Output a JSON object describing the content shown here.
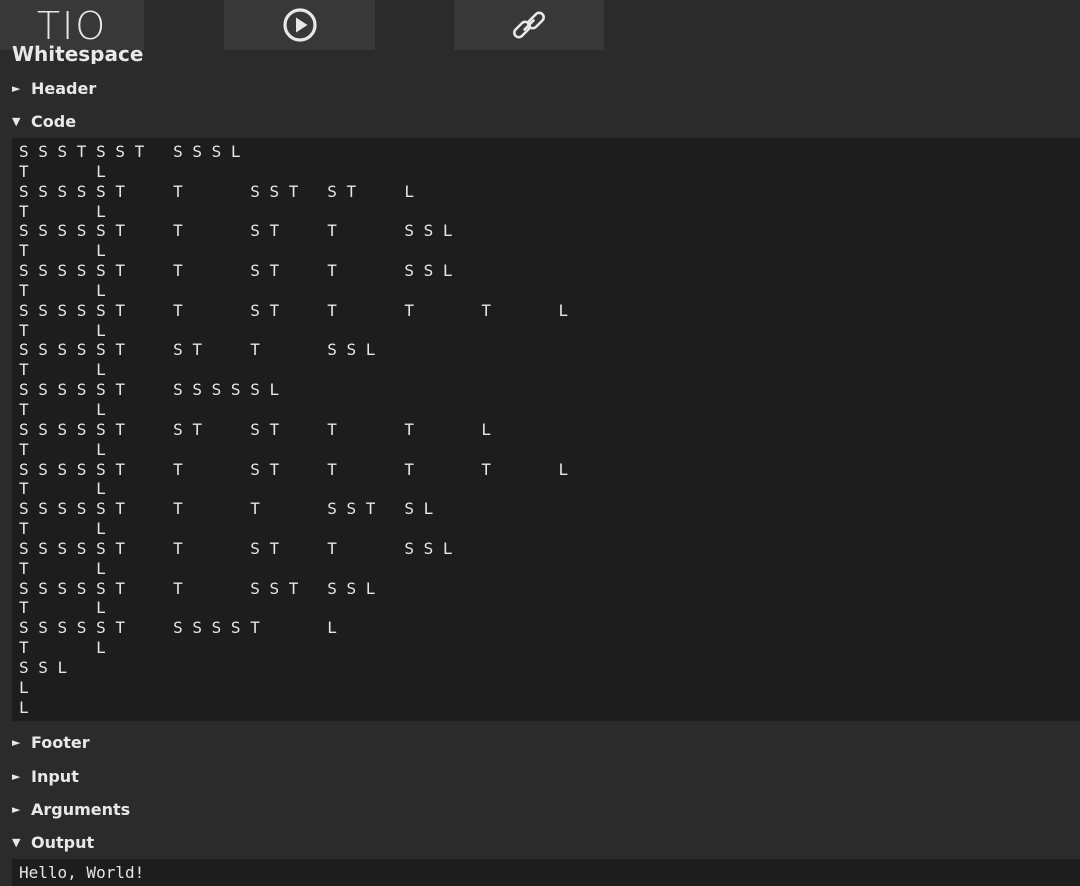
{
  "toolbar": {
    "logo_text": "TIO",
    "buttons": [
      {
        "icon": "logo",
        "label": "TIO"
      },
      {
        "icon": "run-icon"
      },
      {
        "icon": "link-icon"
      }
    ]
  },
  "language": {
    "title": "Whitespace"
  },
  "sections": {
    "header": {
      "label": "Header",
      "expanded": false
    },
    "code": {
      "label": "Code",
      "expanded": true
    },
    "footer": {
      "label": "Footer",
      "expanded": false
    },
    "input": {
      "label": "Input",
      "expanded": false
    },
    "arguments": {
      "label": "Arguments",
      "expanded": false
    },
    "output": {
      "label": "Output",
      "expanded": true
    }
  },
  "code": {
    "text": "S S S T S S T   S S S L\nT       L\nS S S S S T     T       S S T   S T     L\nT       L\nS S S S S T     T       S T     T       S S L\nT       L\nS S S S S T     T       S T     T       S S L\nT       L\nS S S S S T     T       S T     T       T       T       L\nT       L\nS S S S S T     S T     T       S S L\nT       L\nS S S S S T     S S S S S L\nT       L\nS S S S S T     S T     S T     T       T       L\nT       L\nS S S S S T     T       S T     T       T       T       L\nT       L\nS S S S S T     T       T       S S T   S L\nT       L\nS S S S S T     T       S T     T       S S L\nT       L\nS S S S S T     T       S S T   S S L\nT       L\nS S S S S T     S S S S T       L\nT       L\nS S L\nL\nL"
  },
  "output": {
    "text": "Hello, World!"
  },
  "arrows": {
    "collapsed": "►",
    "expanded": "▼"
  }
}
